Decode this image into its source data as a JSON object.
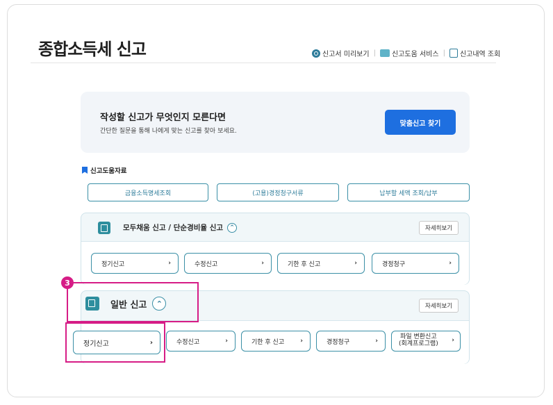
{
  "header": {
    "title": "종합소득세 신고",
    "links": [
      "신고서 미리보기",
      "신고도움 서비스",
      "신고내역 조회"
    ]
  },
  "promo": {
    "title": "작성할 신고가 무엇인지 모른다면",
    "subtitle": "간단한 질문을 통해 나에게 맞는 신고를 찾아 보세요.",
    "button": "맞춤신고 찾기"
  },
  "help": {
    "heading": "신고도움자료",
    "buttons": [
      "금융소득명세조회",
      "(고용)경정청구서류",
      "납부할 세액 조회/납부"
    ]
  },
  "section1": {
    "title": "모두채움 신고 / 단순경비율 신고",
    "detail": "자세히보기",
    "items": [
      "정기신고",
      "수정신고",
      "기한 후 신고",
      "경정청구"
    ]
  },
  "section2": {
    "title": "일반 신고",
    "detail": "자세히보기",
    "items": [
      "정기신고",
      "수정신고",
      "기한 후 신고",
      "경정청구"
    ],
    "last_item_line1": "파일 변환신고",
    "last_item_line2": "(회계프로그램)"
  },
  "annotation": {
    "step": "3"
  },
  "glyphs": {
    "arrow": "›",
    "chevron_up": "⌃"
  },
  "colors": {
    "accent": "#1e6fe0",
    "teal": "#2e7c9a",
    "highlight": "#d61c86"
  }
}
